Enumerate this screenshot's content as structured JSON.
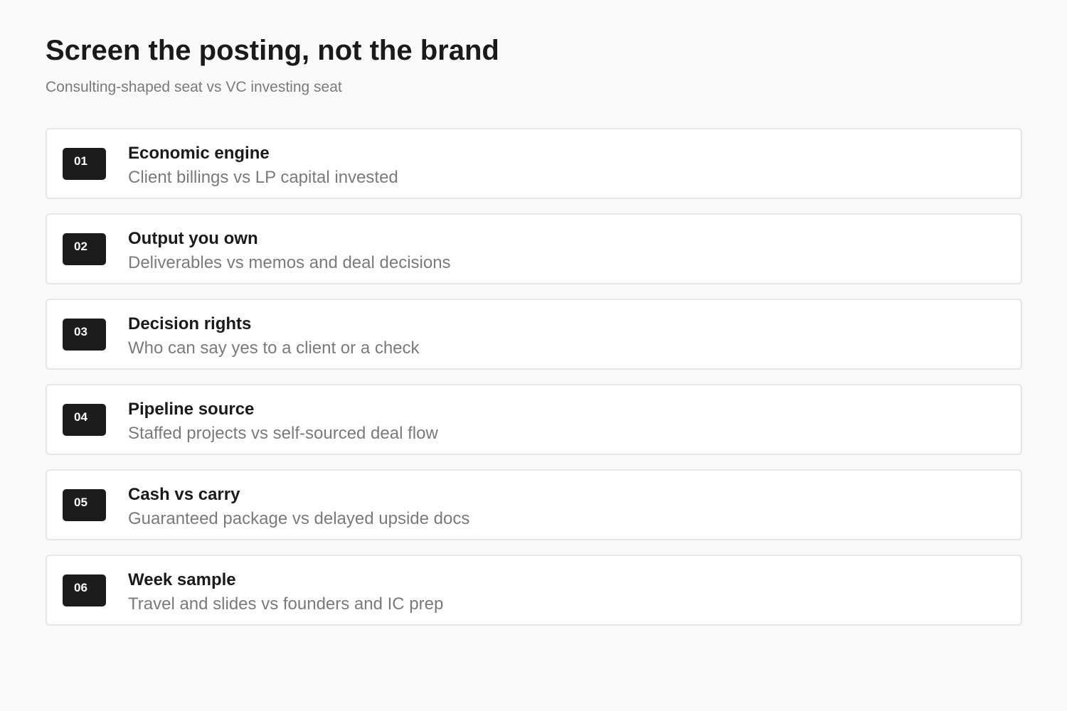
{
  "header": {
    "title": "Screen the posting, not the brand",
    "subtitle": "Consulting-shaped seat vs VC investing seat"
  },
  "items": [
    {
      "number": "01",
      "title": "Economic engine",
      "description": "Client billings vs LP capital invested"
    },
    {
      "number": "02",
      "title": "Output you own",
      "description": "Deliverables vs memos and deal decisions"
    },
    {
      "number": "03",
      "title": "Decision rights",
      "description": "Who can say yes to a client or a check"
    },
    {
      "number": "04",
      "title": "Pipeline source",
      "description": "Staffed projects vs self-sourced deal flow"
    },
    {
      "number": "05",
      "title": "Cash vs carry",
      "description": "Guaranteed package vs delayed upside docs"
    },
    {
      "number": "06",
      "title": "Week sample",
      "description": "Travel and slides vs founders and IC prep"
    }
  ],
  "colors": {
    "background": "#f9f9f9",
    "card": "#ffffff",
    "card_border": "#e6e6e6",
    "badge": "#1c1c1e",
    "title_text": "#1a1a1a",
    "muted_text": "#7a7a7a"
  }
}
